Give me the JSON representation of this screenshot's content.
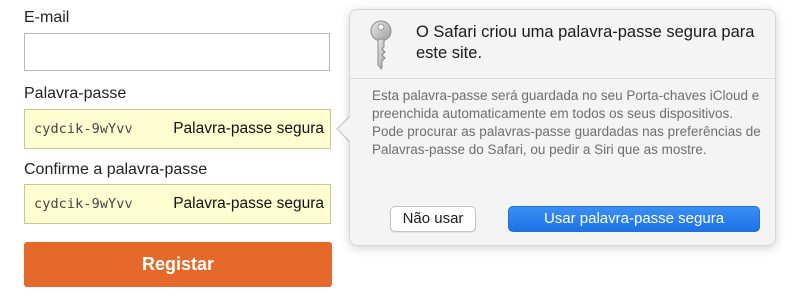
{
  "form": {
    "email_label": "E-mail",
    "email_value": "",
    "password_label": "Palavra-passe",
    "password_value": "cydcik-9wYvv",
    "password_tag": "Palavra-passe segura",
    "confirm_label": "Confirme a palavra-passe",
    "confirm_value": "cydcik-9wYvv",
    "confirm_tag": "Palavra-passe segura",
    "register_label": "Registar"
  },
  "popover": {
    "icon": "key-icon",
    "title": "O Safari criou uma palavra-passe segura para este site.",
    "body": "Esta palavra-passe será guardada no seu Porta-chaves iCloud e preenchida automaticamente em todos os seus dispositivos. Pode procurar as palavras-passe guardadas nas preferências de Palavras-passe do Safari, ou pedir a Siri que as mostre.",
    "decline_label": "Não usar",
    "accept_label": "Usar palavra-passe segura"
  },
  "colors": {
    "register_button": "#e4692a",
    "autofill_background": "#fefed0",
    "accept_button": "#1d73e8"
  }
}
